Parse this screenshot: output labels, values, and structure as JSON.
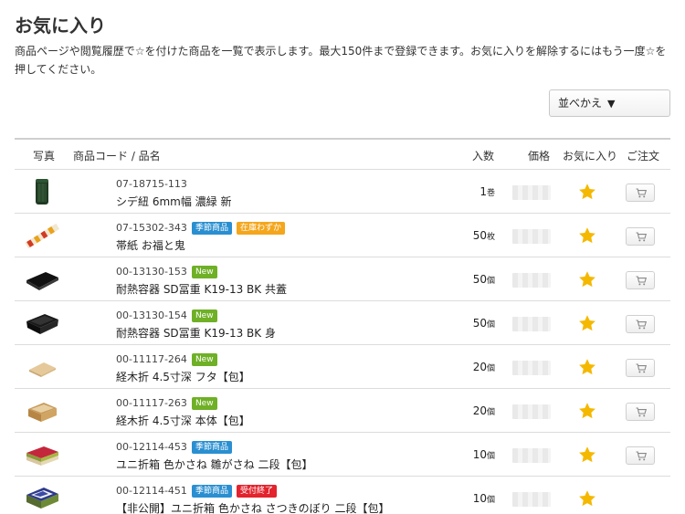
{
  "page": {
    "title": "お気に入り",
    "description": "商品ページや閲覧履歴で☆を付けた商品を一覧で表示します。最大150件まで登録できます。お気に入りを解除するにはもう一度☆を押してください。",
    "sort_label": "並べかえ",
    "sort_arrow": "▼"
  },
  "table": {
    "headers": {
      "photo": "写真",
      "code_name": "商品コード / 品名",
      "qty": "入数",
      "price": "価格",
      "favorite": "お気に入り",
      "order": "ご注文"
    },
    "rows": [
      {
        "code": "07-18715-113",
        "badges": [],
        "name": "シデ紐 6mm幅 濃緑 新",
        "qty": "1",
        "unit": "巻",
        "thumb": "twine-spool",
        "favorite": true,
        "has_order": true
      },
      {
        "code": "07-15302-343",
        "badges": [
          {
            "text": "季節商品",
            "kind": "season"
          },
          {
            "text": "在庫わずか",
            "kind": "stock"
          }
        ],
        "name": "帯紙 お福と鬼",
        "qty": "50",
        "unit": "枚",
        "thumb": "paper-band",
        "favorite": true,
        "has_order": true
      },
      {
        "code": "00-13130-153",
        "badges": [
          {
            "text": "New",
            "kind": "new"
          }
        ],
        "name": "耐熱容器 SD冨重 K19-13 BK 共蓋",
        "qty": "50",
        "unit": "個",
        "thumb": "black-lid",
        "favorite": true,
        "has_order": true
      },
      {
        "code": "00-13130-154",
        "badges": [
          {
            "text": "New",
            "kind": "new"
          }
        ],
        "name": "耐熱容器 SD冨重 K19-13 BK 身",
        "qty": "50",
        "unit": "個",
        "thumb": "black-tray",
        "favorite": true,
        "has_order": true
      },
      {
        "code": "00-11117-264",
        "badges": [
          {
            "text": "New",
            "kind": "new"
          }
        ],
        "name": "経木折 4.5寸深 フタ【包】",
        "qty": "20",
        "unit": "個",
        "thumb": "wood-lid",
        "favorite": true,
        "has_order": true
      },
      {
        "code": "00-11117-263",
        "badges": [
          {
            "text": "New",
            "kind": "new"
          }
        ],
        "name": "経木折 4.5寸深 本体【包】",
        "qty": "20",
        "unit": "個",
        "thumb": "wood-box",
        "favorite": true,
        "has_order": true
      },
      {
        "code": "00-12114-453",
        "badges": [
          {
            "text": "季節商品",
            "kind": "season"
          }
        ],
        "name": "ユニ折箱 色かさね 雛がさね 二段【包】",
        "qty": "10",
        "unit": "個",
        "thumb": "hina-box",
        "favorite": true,
        "has_order": true
      },
      {
        "code": "00-12114-451",
        "badges": [
          {
            "text": "季節商品",
            "kind": "season"
          },
          {
            "text": "受付終了",
            "kind": "end"
          }
        ],
        "name": "【非公開】ユニ折箱 色かさね さつきのぼり 二段【包】",
        "qty": "10",
        "unit": "個",
        "thumb": "satsuki-box",
        "favorite": true,
        "has_order": false
      }
    ]
  },
  "colors": {
    "star": "#f5b800",
    "badge_season": "#2a8fd1",
    "badge_stock": "#f4a61d",
    "badge_new": "#6fb026",
    "badge_end": "#e3232d"
  },
  "icons": {
    "favorite": "star-icon",
    "order": "cart-icon"
  }
}
